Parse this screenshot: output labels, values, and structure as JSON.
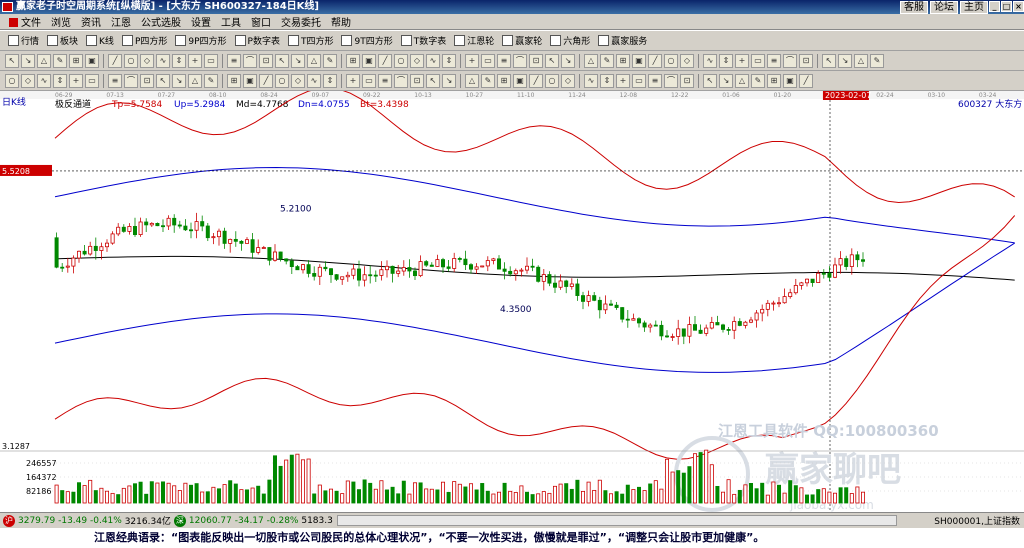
{
  "window": {
    "title": "赢家老子时空周期系统[纵横版] - [大东方  SH600327-184日K线]",
    "links": [
      "客服",
      "论坛",
      "主页"
    ],
    "controls": [
      "_",
      "□",
      "×"
    ]
  },
  "menu": [
    "文件",
    "浏览",
    "资讯",
    "江恩",
    "公式选股",
    "设置",
    "工具",
    "窗口",
    "交易委托",
    "帮助"
  ],
  "toolbar1": [
    {
      "label": "行情",
      "icon": "grid-icon"
    },
    {
      "label": "板块",
      "icon": "blocks-icon"
    },
    {
      "label": "K线",
      "icon": "candle-icon"
    },
    {
      "label": "P四方形",
      "icon": "square-p-icon"
    },
    {
      "label": "9P四方形",
      "icon": "square-9p-icon"
    },
    {
      "label": "P数字表",
      "icon": "table-p-icon"
    },
    {
      "label": "T四方形",
      "icon": "square-t-icon"
    },
    {
      "label": "9T四方形",
      "icon": "square-9t-icon"
    },
    {
      "label": "T数字表",
      "icon": "table-t-icon"
    },
    {
      "label": "江恩轮",
      "icon": "wheel-icon"
    },
    {
      "label": "赢家轮",
      "icon": "winner-wheel-icon"
    },
    {
      "label": "六角形",
      "icon": "hexagon-icon"
    },
    {
      "label": "赢家服务",
      "icon": "service-icon"
    }
  ],
  "toolbar2_count": 52,
  "toolbar3_count": 48,
  "chart_data": {
    "type": "candlestick",
    "period_label": "日K线",
    "indicator": {
      "name": "极反通道",
      "params": [
        {
          "key": "Tp",
          "value": "5.7584",
          "color": "#cc0000"
        },
        {
          "key": "Up",
          "value": "5.2984",
          "color": "#0000cc"
        },
        {
          "key": "Md",
          "value": "4.7768",
          "color": "#000000"
        },
        {
          "key": "Dn",
          "value": "4.0755",
          "color": "#0000cc"
        },
        {
          "key": "Bt",
          "value": "3.4398",
          "color": "#cc0000"
        }
      ]
    },
    "symbol": "600327",
    "name": "大东方",
    "date_ticks": [
      "06-29",
      "07-13",
      "07-27",
      "08-10",
      "08-24",
      "09-07",
      "09-22",
      "10-13",
      "10-27",
      "11-10",
      "11-24",
      "12-08",
      "12-22",
      "01-06",
      "01-20",
      "2023-02-07",
      "02-24",
      "03-10",
      "03-24"
    ],
    "crosshair_date": "2023-02-07",
    "crosshair_price": "5.5208",
    "price_low_label": "3.1287",
    "annotations": {
      "high": "5.2100",
      "low": "4.3500"
    },
    "volume_ticks": [
      "246557",
      "164372",
      "82186"
    ],
    "colors": {
      "up": "#cc0000",
      "down": "#008800",
      "tp_bt": "#cc0000",
      "up_dn": "#0000cc",
      "md": "#000000"
    },
    "candles_note": "184 daily bars",
    "price_range": [
      3.1287,
      6.05
    ]
  },
  "watermark": {
    "line1": "江恩工具软件  QQ:100800360",
    "line2": "赢家聊吧",
    "line3": "jiaoba.yx.com"
  },
  "status": {
    "index1": "3279.79",
    "index1_change": "-13.49",
    "index1_pct": "-0.41%",
    "index1_amount": "3216.34亿",
    "index2": "12060.77",
    "index2_change": "-34.17",
    "index2_pct": "-0.28%",
    "index2_amount": "5183.3",
    "code": "SH000001,上证指数"
  },
  "quote": "江恩经典语录：“图表能反映出一切股市或公司股民的总体心理状况”，“不要一次性买进，傲慢就是罪过”，“调整只会让股市更加健康”。"
}
